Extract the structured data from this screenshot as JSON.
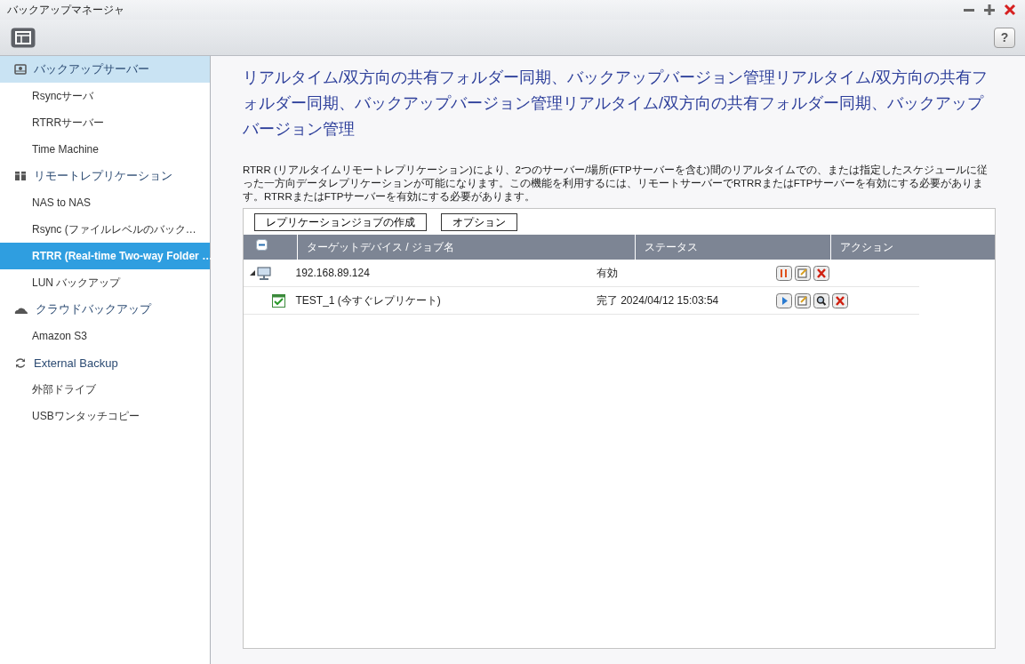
{
  "window": {
    "title": "バックアップマネージャ"
  },
  "toolbar": {
    "help": "?"
  },
  "sidebar": {
    "items": [
      {
        "kind": "group",
        "label": "バックアップサーバー",
        "selected": false,
        "highlighted": true
      },
      {
        "kind": "item",
        "label": "Rsyncサーバ",
        "selected": false
      },
      {
        "kind": "item",
        "label": "RTRRサーバー",
        "selected": false
      },
      {
        "kind": "item",
        "label": "Time Machine",
        "selected": false
      },
      {
        "kind": "group",
        "label": "リモートレプリケーション",
        "selected": false,
        "highlighted": false
      },
      {
        "kind": "item",
        "label": "NAS to NAS",
        "selected": false
      },
      {
        "kind": "item",
        "label": "Rsync (ファイルレベルのバック…",
        "selected": false
      },
      {
        "kind": "item",
        "label": "RTRR (Real-time Two-way Folder …",
        "selected": true
      },
      {
        "kind": "item",
        "label": "LUN バックアップ",
        "selected": false
      },
      {
        "kind": "group",
        "label": "クラウドバックアップ",
        "selected": false,
        "highlighted": false
      },
      {
        "kind": "item",
        "label": "Amazon S3",
        "selected": false
      },
      {
        "kind": "group",
        "label": "External Backup",
        "selected": false,
        "highlighted": false
      },
      {
        "kind": "item",
        "label": "外部ドライブ",
        "selected": false
      },
      {
        "kind": "item",
        "label": "USBワンタッチコピー",
        "selected": false
      }
    ]
  },
  "content": {
    "heading": "リアルタイム/双方向の共有フォルダー同期、バックアップバージョン管理リアルタイム/双方向の共有フォルダー同期、バックアップバージョン管理リアルタイム/双方向の共有フォルダー同期、バックアップバージョン管理",
    "description": "RTRR (リアルタイムリモートレプリケーション)により、2つのサーバー/場所(FTPサーバーを含む)間のリアルタイムでの、または指定したスケジュールに従った一方向データレプリケーションが可能になります。この機能を利用するには、リモートサーバーでRTRRまたはFTPサーバーを有効にする必要があります。RTRRまたはFTPサーバーを有効にする必要があります。",
    "buttons": [
      "レプリケーションジョブの作成",
      "オプション"
    ],
    "table": {
      "columns": [
        "ターゲットデバイス / ジョブ名",
        "ステータス",
        "アクション"
      ],
      "rows": [
        {
          "kind": "device",
          "expanded": true,
          "name": "192.168.89.124",
          "status": "有効",
          "actions": [
            {
              "kind": "pause"
            },
            {
              "kind": "edit"
            },
            {
              "kind": "delete"
            }
          ]
        },
        {
          "kind": "job",
          "name": "TEST_1 (今すぐレプリケート)",
          "status": "完了 2024/04/12 15:03:54",
          "actions": [
            {
              "kind": "play"
            },
            {
              "kind": "edit"
            },
            {
              "kind": "view"
            },
            {
              "kind": "delete"
            }
          ]
        }
      ]
    }
  }
}
